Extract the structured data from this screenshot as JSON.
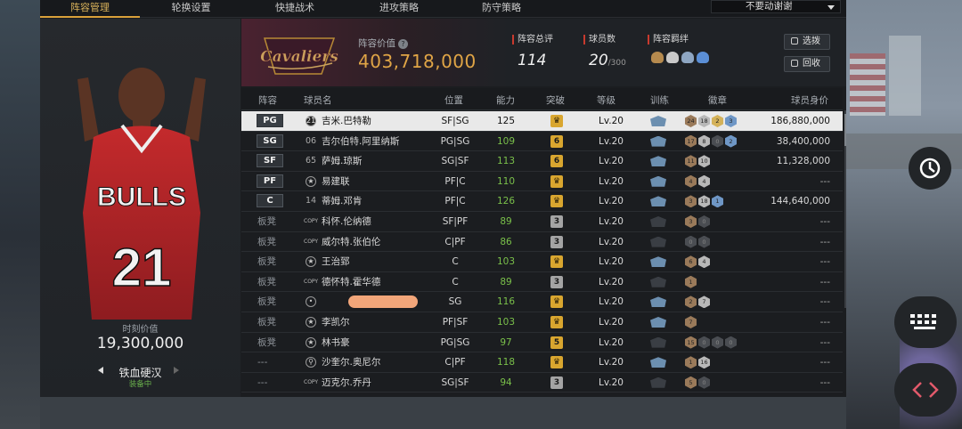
{
  "tabs": [
    {
      "label": "阵容管理",
      "active": true
    },
    {
      "label": "轮换设置",
      "active": false
    },
    {
      "label": "快捷战术",
      "active": false
    },
    {
      "label": "进攻策略",
      "active": false
    },
    {
      "label": "防守策略",
      "active": false
    }
  ],
  "dropdown": {
    "selected": "不要动谢谢"
  },
  "player_card": {
    "value_label": "时刻价值",
    "value": "19,300,000",
    "skin_name": "铁血硬汉",
    "status": "装备中",
    "jersey_team": "BULLS",
    "jersey_number": "21"
  },
  "summary": {
    "team_logo_text": "Cavaliers",
    "lineup_value_label": "阵容价值",
    "lineup_value": "403,718,000",
    "overall_label": "阵容总评",
    "overall_value": "114",
    "count_label": "球员数",
    "count_value": "20",
    "count_max": "/300",
    "bond_label": "阵容羁绊",
    "select_button": "选拨",
    "recycle_button": "回收"
  },
  "table": {
    "headers": [
      "阵容",
      "球员名",
      "位置",
      "能力",
      "突破",
      "等级",
      "训练",
      "徽章",
      "球员身价"
    ],
    "rows": [
      {
        "slot": "PG",
        "num": "",
        "icon": "jersey",
        "name": "吉米.巴特勒",
        "pos": "SF|SG",
        "ability": "125",
        "break": "crown",
        "level": "Lv.20",
        "train": "blue",
        "badges": [
          [
            "24",
            "b"
          ],
          [
            "18",
            "s"
          ],
          [
            "2",
            "g"
          ],
          [
            "3",
            "bl"
          ]
        ],
        "salary": "186,880,000"
      },
      {
        "slot": "SG",
        "num": "06",
        "icon": "",
        "name": "吉尔伯特.阿里纳斯",
        "pos": "PG|SG",
        "ability": "109",
        "break": "6",
        "level": "Lv.20",
        "train": "blue",
        "badges": [
          [
            "17",
            "b"
          ],
          [
            "8",
            "s"
          ],
          [
            "0",
            "d"
          ],
          [
            "2",
            "bl"
          ]
        ],
        "salary": "38,400,000"
      },
      {
        "slot": "SF",
        "num": "65",
        "icon": "",
        "name": "萨姆.琼斯",
        "pos": "SG|SF",
        "ability": "113",
        "break": "6",
        "level": "Lv.20",
        "train": "blue",
        "badges": [
          [
            "11",
            "b"
          ],
          [
            "10",
            "s"
          ]
        ],
        "salary": "11,328,000"
      },
      {
        "slot": "PF",
        "num": "",
        "icon": "star",
        "name": "易建联",
        "pos": "PF|C",
        "ability": "110",
        "break": "crown",
        "level": "Lv.20",
        "train": "blue",
        "badges": [
          [
            "4",
            "b"
          ],
          [
            "4",
            "s"
          ]
        ],
        "salary": "---"
      },
      {
        "slot": "C",
        "num": "14",
        "icon": "",
        "name": "蒂姆.邓肯",
        "pos": "PF|C",
        "ability": "126",
        "break": "crown",
        "level": "Lv.20",
        "train": "blue",
        "badges": [
          [
            "3",
            "b"
          ],
          [
            "18",
            "s"
          ],
          [
            "1",
            "bl"
          ]
        ],
        "salary": "144,640,000"
      },
      {
        "slot": "板凳",
        "num": "",
        "icon": "copy",
        "name": "科怀.伦纳德",
        "pos": "SF|PF",
        "ability": "89",
        "break": "3",
        "level": "Lv.20",
        "train": "dark",
        "badges": [
          [
            "3",
            "b"
          ],
          [
            "0",
            "d"
          ]
        ],
        "salary": "---"
      },
      {
        "slot": "板凳",
        "num": "",
        "icon": "copy",
        "name": "威尔特.张伯伦",
        "pos": "C|PF",
        "ability": "86",
        "break": "3",
        "level": "Lv.20",
        "train": "dark",
        "badges": [
          [
            "0",
            "d"
          ],
          [
            "0",
            "d"
          ]
        ],
        "salary": "---"
      },
      {
        "slot": "板凳",
        "num": "",
        "icon": "star",
        "name": "王治郅",
        "pos": "C",
        "ability": "103",
        "break": "crown",
        "level": "Lv.20",
        "train": "blue",
        "badges": [
          [
            "6",
            "b"
          ],
          [
            "4",
            "s"
          ]
        ],
        "salary": "---"
      },
      {
        "slot": "板凳",
        "num": "",
        "icon": "copy",
        "name": "德怀特.霍华德",
        "pos": "C",
        "ability": "89",
        "break": "3",
        "level": "Lv.20",
        "train": "dark",
        "badges": [
          [
            "1",
            "b"
          ]
        ],
        "salary": "---"
      },
      {
        "slot": "板凳",
        "num": "",
        "icon": "redacted",
        "name": "",
        "pos": "SG",
        "ability": "116",
        "break": "crown",
        "level": "Lv.20",
        "train": "blue",
        "badges": [
          [
            "2",
            "b"
          ],
          [
            "7",
            "s"
          ]
        ],
        "salary": "---"
      },
      {
        "slot": "板凳",
        "num": "",
        "icon": "star",
        "name": "李凯尔",
        "pos": "PF|SF",
        "ability": "103",
        "break": "crown",
        "level": "Lv.20",
        "train": "blue",
        "badges": [
          [
            "7",
            "b"
          ]
        ],
        "salary": "---"
      },
      {
        "slot": "板凳",
        "num": "",
        "icon": "star",
        "name": "林书豪",
        "pos": "PG|SG",
        "ability": "97",
        "break": "5",
        "level": "Lv.20",
        "train": "dark",
        "badges": [
          [
            "15",
            "b"
          ],
          [
            "0",
            "d"
          ],
          [
            "0",
            "d"
          ],
          [
            "0",
            "d"
          ]
        ],
        "salary": "---"
      },
      {
        "slot": "---",
        "num": "",
        "icon": "pin",
        "name": "沙奎尔.奥尼尔",
        "pos": "C|PF",
        "ability": "118",
        "break": "crown",
        "level": "Lv.20",
        "train": "blue",
        "badges": [
          [
            "1",
            "b"
          ],
          [
            "16",
            "s"
          ]
        ],
        "salary": "---"
      },
      {
        "slot": "---",
        "num": "",
        "icon": "copy",
        "name": "迈克尔.乔丹",
        "pos": "SG|SF",
        "ability": "94",
        "break": "3",
        "level": "Lv.20",
        "train": "dark",
        "badges": [
          [
            "5",
            "b"
          ],
          [
            "0",
            "d"
          ]
        ],
        "salary": "---"
      }
    ]
  },
  "icons": {
    "help": "question-icon",
    "train": "shield-icon",
    "float_clock": "clock-icon",
    "float_keyboard": "keyboard-icon",
    "float_code": "code-icon"
  },
  "colors": {
    "accent": "#d9a03a",
    "lineup_value": "#e0a546",
    "ability": "#7ac04a",
    "selected_row": "#e9e9e9"
  }
}
